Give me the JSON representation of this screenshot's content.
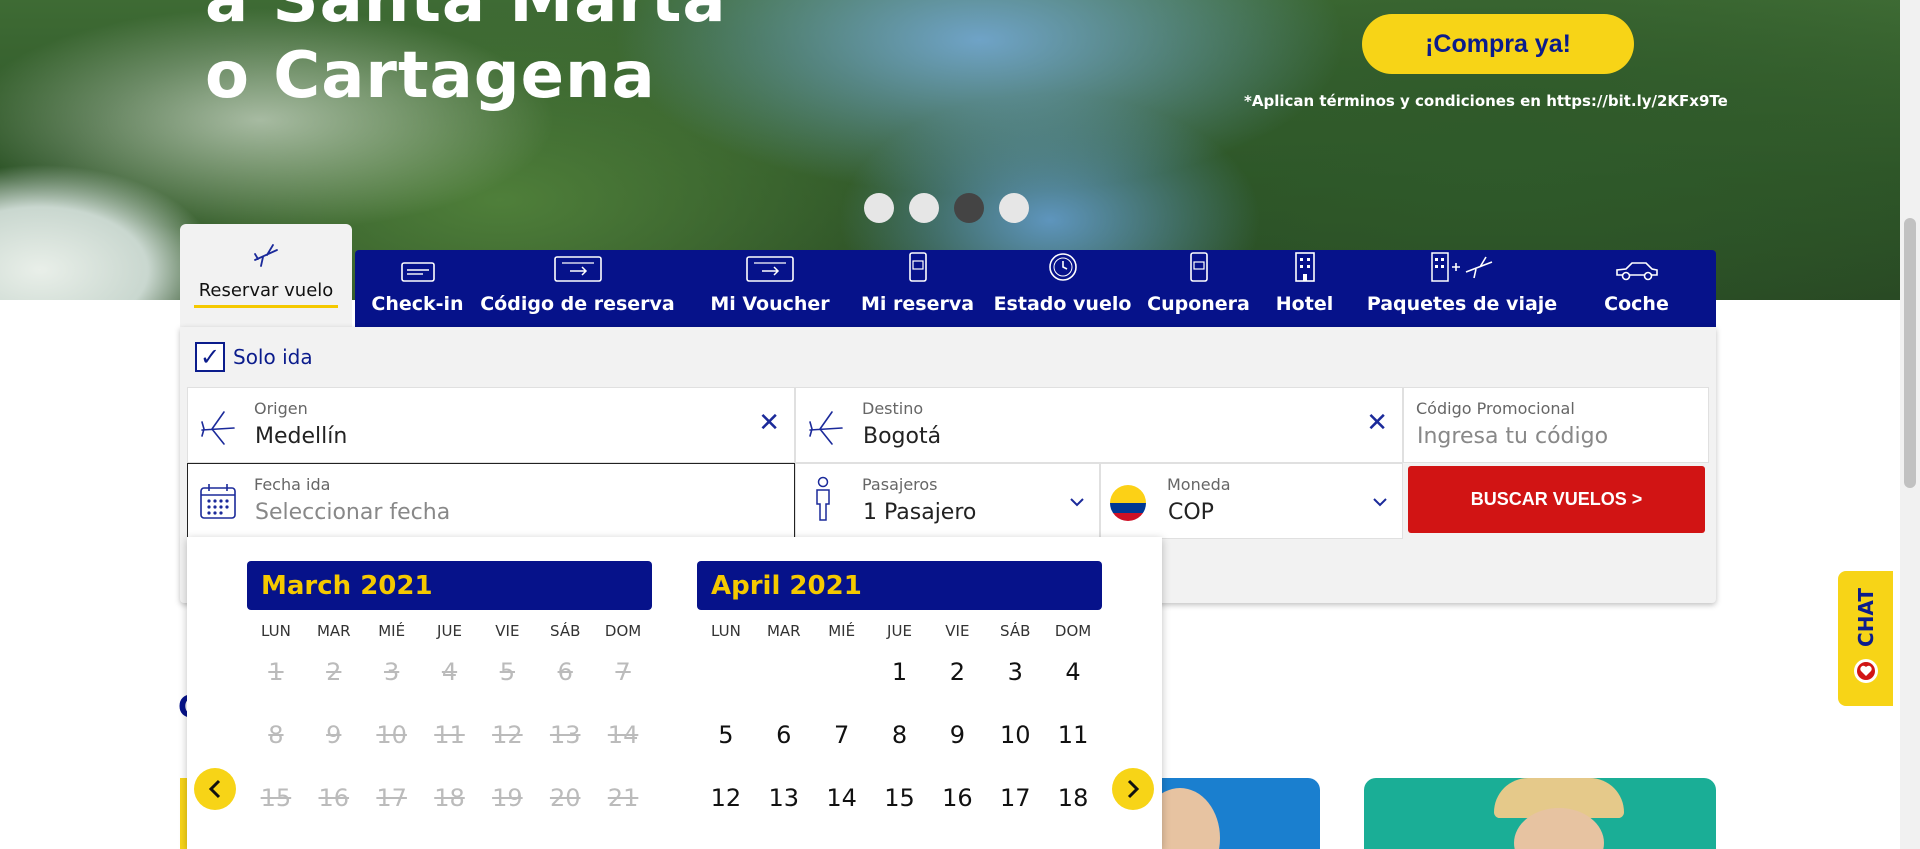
{
  "hero": {
    "title_line1": "a Santa Marta",
    "title_line2": "o Cartagena",
    "cta": "¡Compra ya!",
    "terms": "*Aplican términos y condiciones en https://bit.ly/2KFx9Te",
    "slides_total": 4,
    "active_slide": 3
  },
  "tabs": {
    "active": "Reservar vuelo",
    "items": [
      {
        "label": "Check-in",
        "icon": "ticket-icon"
      },
      {
        "label": "Código de reserva",
        "icon": "boarding-pass-icon"
      },
      {
        "label": "Mi Voucher",
        "icon": "voucher-icon"
      },
      {
        "label": "Mi reserva",
        "icon": "phone-ticket-icon"
      },
      {
        "label": "Estado vuelo",
        "icon": "clock-icon"
      },
      {
        "label": "Cuponera",
        "icon": "coupon-phone-icon"
      },
      {
        "label": "Hotel",
        "icon": "hotel-icon"
      },
      {
        "label": "Paquetes de viaje",
        "icon": "hotel-plus-plane-icon"
      },
      {
        "label": "Coche",
        "icon": "car-icon"
      }
    ]
  },
  "search": {
    "one_way_label": "Solo ida",
    "one_way_checked": true,
    "origin": {
      "label": "Origen",
      "value": "Medellín"
    },
    "destination": {
      "label": "Destino",
      "value": "Bogotá"
    },
    "promo": {
      "label": "Código Promocional",
      "placeholder": "Ingresa tu código"
    },
    "date": {
      "label": "Fecha ida",
      "placeholder": "Seleccionar fecha"
    },
    "passengers": {
      "label": "Pasajeros",
      "value": "1 Pasajero"
    },
    "currency": {
      "label": "Moneda",
      "value": "COP"
    },
    "submit": "BUSCAR VUELOS >"
  },
  "calendar": {
    "weekdays": [
      "LUN",
      "MAR",
      "MIÉ",
      "JUE",
      "VIE",
      "SÁB",
      "DOM"
    ],
    "months": [
      {
        "title": "March 2021",
        "offset": 0,
        "days": [
          "1",
          "2",
          "3",
          "4",
          "5",
          "6",
          "7",
          "8",
          "9",
          "10",
          "11",
          "12",
          "13",
          "14",
          "15",
          "16",
          "17",
          "18",
          "19",
          "20",
          "21"
        ],
        "disabled_through": 21
      },
      {
        "title": "April 2021",
        "offset": 3,
        "days": [
          "1",
          "2",
          "3",
          "4",
          "5",
          "6",
          "7",
          "8",
          "9",
          "10",
          "11",
          "12",
          "13",
          "14",
          "15",
          "16",
          "17",
          "18"
        ],
        "disabled_through": 0
      }
    ],
    "prev": "‹",
    "next": "›"
  },
  "chat": {
    "label": "CHAT"
  },
  "section": {
    "heading_peek": "C"
  },
  "colors": {
    "brand_blue": "#06128a",
    "accent_yellow": "#f7d417",
    "cta_red": "#d11414"
  }
}
